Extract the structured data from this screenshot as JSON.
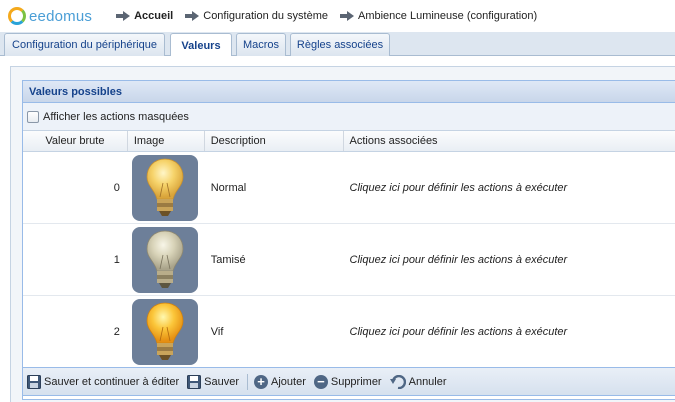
{
  "app": {
    "logo_text": "eedomus"
  },
  "breadcrumb": [
    "Accueil",
    "Configuration du système",
    "Ambience Lumineuse (configuration)"
  ],
  "tabs": [
    {
      "label": "Configuration du périphérique",
      "active": false
    },
    {
      "label": "Valeurs",
      "active": true
    },
    {
      "label": "Macros",
      "active": false
    },
    {
      "label": "Règles associées",
      "active": false
    }
  ],
  "panel": {
    "title": "Valeurs possibles",
    "show_hidden_label": "Afficher les actions masquées",
    "columns": [
      "Valeur brute",
      "Image",
      "Description",
      "Actions associées"
    ],
    "rows": [
      {
        "value": "0",
        "image": "bulb-icon",
        "description": "Normal",
        "action": "Cliquez ici pour définir les actions à exécuter"
      },
      {
        "value": "1",
        "image": "bulb-icon",
        "description": "Tamisé",
        "action": "Cliquez ici pour définir les actions à exécuter"
      },
      {
        "value": "2",
        "image": "bulb-icon",
        "description": "Vif",
        "action": "Cliquez ici pour définir les actions à exécuter"
      }
    ]
  },
  "toolbar": {
    "save_continue": "Sauver et continuer à éditer",
    "save": "Sauver",
    "add": "Ajouter",
    "delete": "Supprimer",
    "cancel": "Annuler"
  },
  "colors": {
    "accent": "#15428b",
    "header_bg": "#dfe8f6",
    "bulb_bg": "#6d7f99"
  }
}
